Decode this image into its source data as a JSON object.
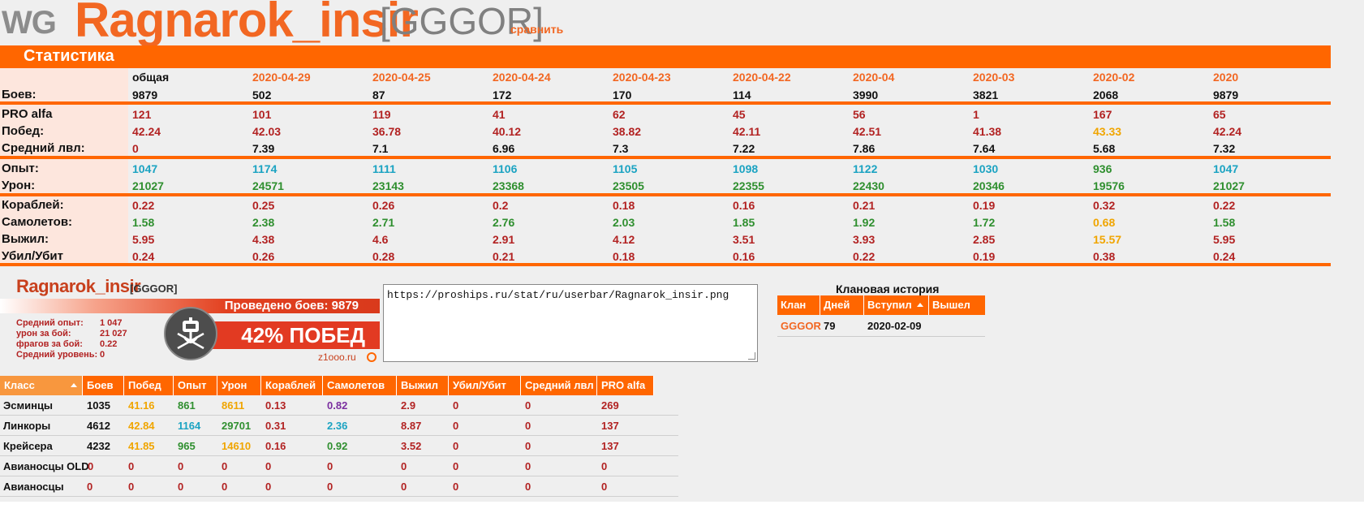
{
  "header": {
    "logo": "WG",
    "nick": "Ragnarok_insir",
    "clan_tag": "[GGGOR]",
    "compare_link": "сравнить"
  },
  "stats_title": "Статистика",
  "columns": [
    "общая",
    "2020-04-29",
    "2020-04-25",
    "2020-04-24",
    "2020-04-23",
    "2020-04-22",
    "2020-04",
    "2020-03",
    "2020-02",
    "2020"
  ],
  "rows": [
    {
      "label": "Боев:",
      "values": [
        "9879",
        "502",
        "87",
        "172",
        "170",
        "114",
        "3990",
        "3821",
        "2068",
        "9879"
      ]
    },
    {
      "label": "PRO alfa",
      "values": [
        "121",
        "101",
        "119",
        "41",
        "62",
        "45",
        "56",
        "1",
        "167",
        "65"
      ]
    },
    {
      "label": "Побед:",
      "values": [
        "42.24",
        "42.03",
        "36.78",
        "40.12",
        "38.82",
        "42.11",
        "42.51",
        "41.38",
        "43.33",
        "42.24"
      ]
    },
    {
      "label": "Средний лвл:",
      "values": [
        "0",
        "7.39",
        "7.1",
        "6.96",
        "7.3",
        "7.22",
        "7.86",
        "7.64",
        "5.68",
        "7.32"
      ]
    },
    {
      "label": "Опыт:",
      "values": [
        "1047",
        "1174",
        "1111",
        "1106",
        "1105",
        "1098",
        "1122",
        "1030",
        "936",
        "1047"
      ]
    },
    {
      "label": "Урон:",
      "values": [
        "21027",
        "24571",
        "23143",
        "23368",
        "23505",
        "22355",
        "22430",
        "20346",
        "19576",
        "21027"
      ]
    },
    {
      "label": "Кораблей:",
      "values": [
        "0.22",
        "0.25",
        "0.26",
        "0.2",
        "0.18",
        "0.16",
        "0.21",
        "0.19",
        "0.32",
        "0.22"
      ]
    },
    {
      "label": "Самолетов:",
      "values": [
        "1.58",
        "2.38",
        "2.71",
        "2.76",
        "2.03",
        "1.85",
        "1.92",
        "1.72",
        "0.68",
        "1.58"
      ]
    },
    {
      "label": "Выжил:",
      "values": [
        "5.95",
        "4.38",
        "4.6",
        "2.91",
        "4.12",
        "3.51",
        "3.93",
        "2.85",
        "15.57",
        "5.95"
      ]
    },
    {
      "label": "Убил/Убит",
      "values": [
        "0.24",
        "0.26",
        "0.28",
        "0.21",
        "0.18",
        "0.16",
        "0.22",
        "0.19",
        "0.38",
        "0.24"
      ]
    }
  ],
  "userbar": {
    "name": "Ragnarok_insir",
    "tag": "[GGGOR]",
    "battles": "Проведено боев: 9879",
    "stats": [
      {
        "label": "Средний опыт:",
        "value": "1 047"
      },
      {
        "label": "урон за бой:",
        "value": "21 027"
      },
      {
        "label": "фрагов за бой:",
        "value": "0.22"
      },
      {
        "label": "Средний уровень:",
        "value": "0"
      }
    ],
    "wins": "42% ПОБЕД",
    "site": "z1ooo.ru"
  },
  "url_box": {
    "value": "https://proships.ru/stat/ru/userbar/Ragnarok_insir.png"
  },
  "clan_history": {
    "title": "Клановая история",
    "headers": [
      "Клан",
      "Дней",
      "Вступил",
      "Вышел"
    ],
    "row": {
      "clan": "GGGOR",
      "days": "79",
      "joined": "2020-02-09",
      "left": ""
    }
  },
  "class_table": {
    "headers": [
      "Класс",
      "Боев",
      "Побед",
      "Опыт",
      "Урон",
      "Кораблей",
      "Самолетов",
      "Выжил",
      "Убил/Убит",
      "Средний лвл",
      "PRO alfa"
    ],
    "rows": [
      [
        "Эсминцы",
        "1035",
        "41.16",
        "861",
        "8611",
        "0.13",
        "0.82",
        "2.9",
        "0",
        "0",
        "269"
      ],
      [
        "Линкоры",
        "4612",
        "42.84",
        "1164",
        "29701",
        "0.31",
        "2.36",
        "8.87",
        "0",
        "0",
        "137"
      ],
      [
        "Крейсера",
        "4232",
        "41.85",
        "965",
        "14610",
        "0.16",
        "0.92",
        "3.52",
        "0",
        "0",
        "137"
      ],
      [
        "Авианосцы OLD",
        "0",
        "0",
        "0",
        "0",
        "0",
        "0",
        "0",
        "0",
        "0",
        "0"
      ],
      [
        "Авианосцы",
        "0",
        "0",
        "0",
        "0",
        "0",
        "0",
        "0",
        "0",
        "0",
        "0"
      ]
    ]
  },
  "colors": {
    "accent": "#ff6600",
    "nick": "#f26722",
    "red": "#b22222",
    "cyan": "#1ba3c2",
    "green": "#2f8f2f",
    "orange": "#f0a500"
  }
}
